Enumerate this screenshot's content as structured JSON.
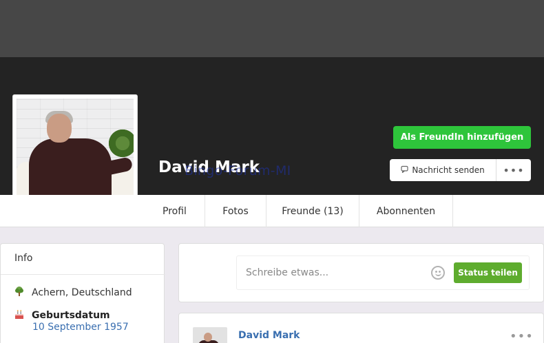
{
  "profile": {
    "name": "David Mark",
    "watermark": "Bingo-Forum-MI"
  },
  "actions": {
    "add_friend_label": "Als FreundIn hinzufügen",
    "message_label": "Nachricht senden",
    "more_label": "•••"
  },
  "tabs": [
    {
      "label": "Profil"
    },
    {
      "label": "Fotos"
    },
    {
      "label": "Freunde (13)"
    },
    {
      "label": "Abonnenten"
    }
  ],
  "info": {
    "title": "Info",
    "location": "Achern, Deutschland",
    "birthday_label": "Geburtsdatum",
    "birthday_value": "10 September 1957"
  },
  "composer": {
    "placeholder": "Schreibe etwas...",
    "submit_label": "Status teilen"
  },
  "post": {
    "author": "David Mark",
    "more_label": "•••"
  },
  "colors": {
    "accent_green": "#2ec53b",
    "link_blue": "#3a6fb0",
    "status_green": "#5eac2e"
  }
}
